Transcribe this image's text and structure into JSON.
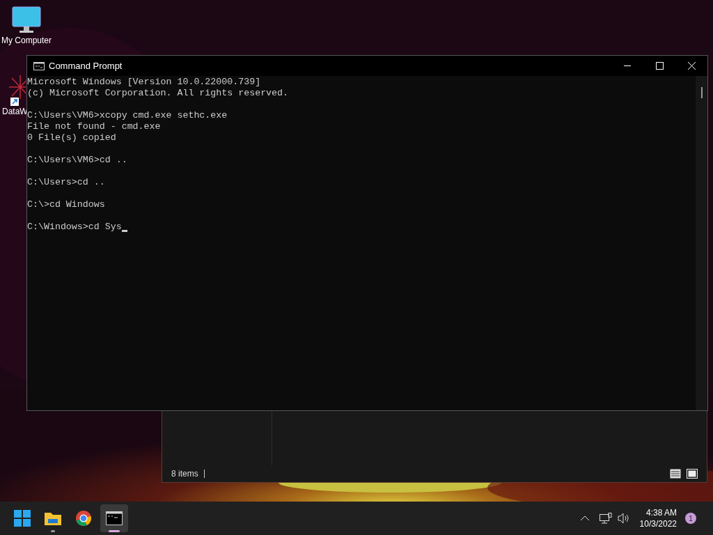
{
  "desktop_icons": [
    {
      "label": "My Computer",
      "kind": "monitor"
    },
    {
      "label": "DataW",
      "kind": "shortcut"
    }
  ],
  "explorer_window": {
    "status": "8 items"
  },
  "console_window": {
    "title": "Command Prompt",
    "blocks": [
      [
        "Microsoft Windows [Version 10.0.22000.739]",
        "(c) Microsoft Corporation. All rights reserved."
      ],
      [
        "C:\\Users\\VM6>xcopy cmd.exe sethc.exe",
        "File not found - cmd.exe",
        "0 File(s) copied"
      ],
      [
        "C:\\Users\\VM6>cd .."
      ],
      [
        "C:\\Users>cd .."
      ],
      [
        "C:\\>cd Windows"
      ]
    ],
    "prompt_line": "C:\\Windows>cd Sys"
  },
  "taskbar": {
    "apps": [
      {
        "kind": "start",
        "running": false,
        "selected": false
      },
      {
        "kind": "folder",
        "running": true,
        "selected": false
      },
      {
        "kind": "browser",
        "running": false,
        "selected": false
      },
      {
        "kind": "terminal",
        "running": true,
        "selected": true
      }
    ],
    "time": "4:38 AM",
    "date": "10/3/2022",
    "notifications": "1"
  }
}
